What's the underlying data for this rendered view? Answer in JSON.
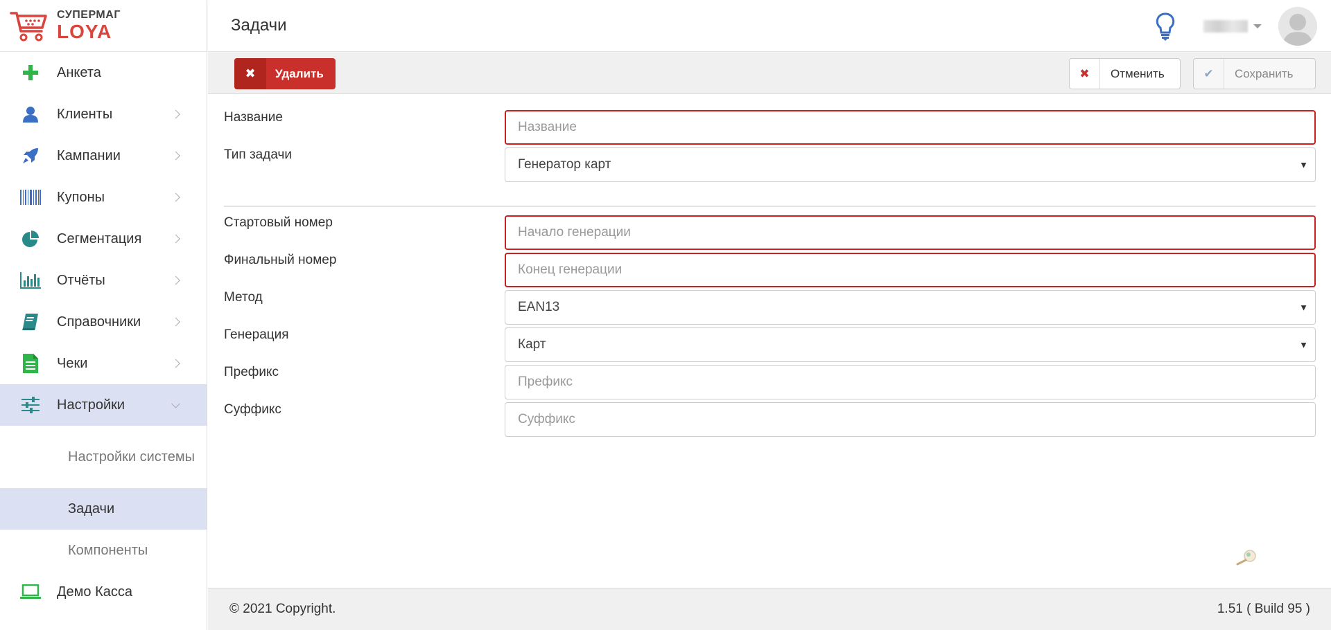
{
  "brand": {
    "top": "СУПЕРМАГ",
    "bottom": "LOYA",
    "accent": "#d9443d"
  },
  "header": {
    "title": "Задачи"
  },
  "sidebar": {
    "items": [
      {
        "label": "Анкета",
        "icon": "plus-icon",
        "has_children": false
      },
      {
        "label": "Клиенты",
        "icon": "user-icon",
        "has_children": true
      },
      {
        "label": "Кампании",
        "icon": "rocket-icon",
        "has_children": true
      },
      {
        "label": "Купоны",
        "icon": "barcode-icon",
        "has_children": true
      },
      {
        "label": "Сегментация",
        "icon": "pie-chart-icon",
        "has_children": true
      },
      {
        "label": "Отчёты",
        "icon": "bar-chart-icon",
        "has_children": true
      },
      {
        "label": "Справочники",
        "icon": "book-icon",
        "has_children": true
      },
      {
        "label": "Чеки",
        "icon": "document-icon",
        "has_children": true
      },
      {
        "label": "Настройки",
        "icon": "sliders-icon",
        "has_children": true,
        "expanded": true
      },
      {
        "label": "Демо Касса",
        "icon": "laptop-icon",
        "has_children": false
      }
    ],
    "subitems": [
      {
        "label": "Настройки системы",
        "active": false
      },
      {
        "label": "Задачи",
        "active": true
      },
      {
        "label": "Компоненты",
        "active": false
      }
    ]
  },
  "toolbar": {
    "delete_label": "Удалить",
    "cancel_label": "Отменить",
    "save_label": "Сохранить"
  },
  "form": {
    "name": {
      "label": "Название",
      "placeholder": "Название",
      "value": "",
      "invalid": true
    },
    "task_type": {
      "label": "Тип задачи",
      "selected": "Генератор карт"
    },
    "start_number": {
      "label": "Стартовый номер",
      "placeholder": "Начало генерации",
      "value": "",
      "invalid": true
    },
    "end_number": {
      "label": "Финальный номер",
      "placeholder": "Конец генерации",
      "value": "",
      "invalid": true
    },
    "method": {
      "label": "Метод",
      "selected": "EAN13"
    },
    "generation": {
      "label": "Генерация",
      "selected": "Карт"
    },
    "prefix": {
      "label": "Префикс",
      "placeholder": "Префикс",
      "value": ""
    },
    "suffix": {
      "label": "Суффикс",
      "placeholder": "Суффикс",
      "value": ""
    }
  },
  "footer": {
    "copyright": "© 2021 Copyright.",
    "version": "1.51 ( Build 95 )"
  },
  "colors": {
    "danger": "#c9302c",
    "active_bg": "#dbe1f3",
    "icon_green": "#2fb54a",
    "icon_blue": "#3a6fc4"
  }
}
